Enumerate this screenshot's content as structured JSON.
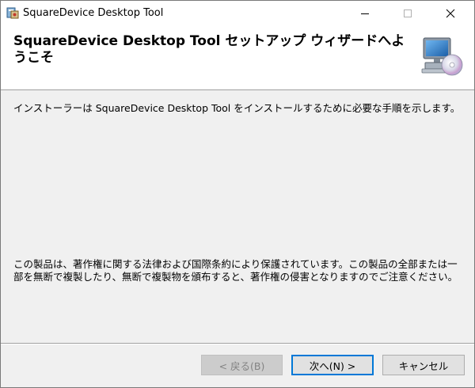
{
  "window": {
    "title": "SquareDevice Desktop Tool",
    "controls": {
      "minimize_icon": "minimize-icon",
      "maximize_icon": "maximize-icon",
      "close_icon": "close-icon"
    }
  },
  "header": {
    "title": "SquareDevice Desktop Tool セットアップ ウィザードへようこそ",
    "icon": "computer-cd-icon"
  },
  "body": {
    "intro": "インストーラーは SquareDevice Desktop Tool をインストールするために必要な手順を示します。",
    "copyright": "この製品は、著作権に関する法律および国際条約により保護されています。この製品の全部または一部を無断で複製したり、無断で複製物を頒布すると、著作権の侵害となりますのでご注意ください。"
  },
  "buttons": {
    "back": {
      "label": "< 戻る(B)",
      "enabled": false
    },
    "next": {
      "label": "次へ(N) >",
      "enabled": true,
      "default": true
    },
    "cancel": {
      "label": "キャンセル",
      "enabled": true
    }
  },
  "colors": {
    "accent": "#0078d7",
    "background": "#f0f0f0",
    "header_background": "#ffffff"
  }
}
